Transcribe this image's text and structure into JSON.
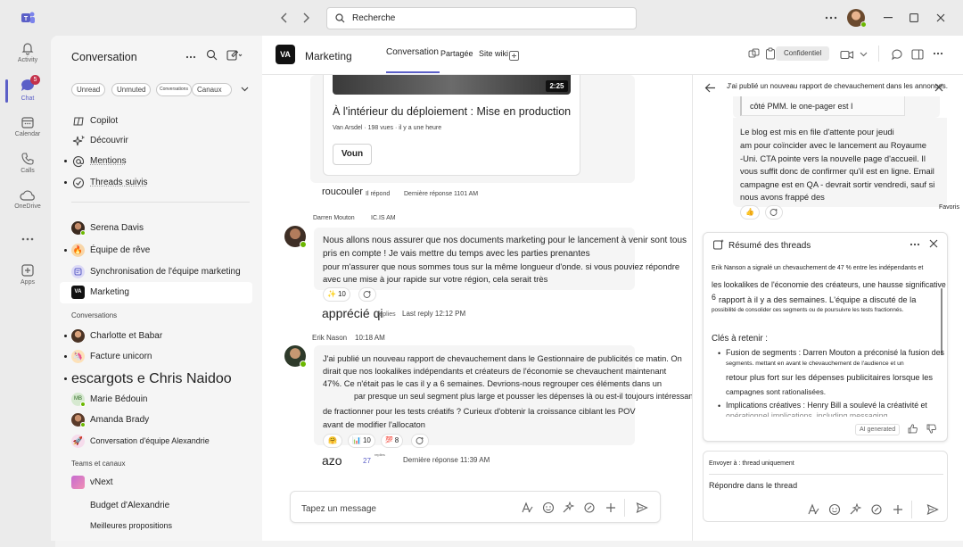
{
  "search": {
    "placeholder": "Recherche"
  },
  "rail": [
    {
      "label": "Activity",
      "icon": "bell-icon"
    },
    {
      "label": "Chat",
      "icon": "chat-icon",
      "badge": "5"
    },
    {
      "label": "Calendar",
      "icon": "calendar-icon"
    },
    {
      "label": "Calls",
      "icon": "phone-icon"
    },
    {
      "label": "OneDrive",
      "icon": "cloud-icon"
    },
    {
      "label": "Apps",
      "icon": "plus-square-icon"
    }
  ],
  "chatlist": {
    "title": "Conversation",
    "filters": [
      "Unread",
      "Unmuted",
      "Conversations",
      "Canaux"
    ],
    "items": [
      {
        "label": "Copilot",
        "icon": "copilot-icon"
      },
      {
        "label": "Découvrir",
        "icon": "sparkle-icon"
      },
      {
        "label": "Mentions",
        "icon": "at-icon"
      },
      {
        "label": "Threads suivis",
        "icon": "thread-icon"
      },
      {
        "label": "Serena Davis",
        "icon": "avatar"
      },
      {
        "label": "Équipe de rêve",
        "icon": "team-icon"
      },
      {
        "label": "Synchronisation de l'équipe marketing",
        "icon": "group-icon"
      },
      {
        "label": "Marketing",
        "icon": "marketing-logo"
      }
    ],
    "conv_header": "Conversations",
    "conversations": [
      {
        "label": "Charlotte et Babar"
      },
      {
        "label": "Facture unicorn"
      },
      {
        "label": "escargots e Chris Naidoo"
      },
      {
        "label": "Marie Bédouin",
        "initials": "MB"
      },
      {
        "label": "Amanda Brady"
      },
      {
        "label": "Conversation d'équipe Alexandrie"
      }
    ],
    "teams_header": "Teams et canaux",
    "teams": [
      {
        "label": "vNext"
      },
      {
        "label": "Budget d'Alexandrie"
      },
      {
        "label": "Meilleures propositions"
      }
    ]
  },
  "channel": {
    "logo": "VA",
    "name": "Marketing",
    "tabs": [
      "Conversation",
      "Partagée",
      "Site wiki"
    ],
    "confidential": "Confidentiel"
  },
  "video_card": {
    "duration": "2:25",
    "title": "À l'intérieur du déploiement : Mise en production",
    "meta_author": "Van Arsdel",
    "meta_views": "198 vues",
    "meta_time": "il y a une heure",
    "button": "Voun"
  },
  "post1_footer": {
    "name": "roucouler",
    "replied": "Il répond",
    "last": "Dernière réponse 1101 AM"
  },
  "msg2": {
    "author": "Darren Mouton",
    "time": "IC.IS AM",
    "line1": "Nous allons nous assurer que nos documents marketing pour le lancement à venir sont tous",
    "line2": "pris en compte ! Je vais mettre du temps avec les parties prenantes",
    "line3": "pour m'assurer que nous sommes tous sur la même longueur d'onde. si vous pouviez répondre",
    "line4": "avec une mise à jour rapide sur votre région, cela serait très",
    "reaction_count": "10",
    "footer_name": "apprécié qi",
    "footer_replies": "replies",
    "footer_last": "Last reply 12:12 PM"
  },
  "msg3": {
    "author": "Erik Nason",
    "time": "10:18 AM",
    "line1": "J'ai publié un nouveau rapport de chevauchement dans le Gestionnaire de publicités ce matin. On",
    "line2": "dirait que nos lookalikes indépendants et créateurs de l'économie se chevauchent maintenant",
    "line3": "47%. Ce n'était pas le cas il y a 6 semaines. Devrions-nous regrouper ces éléments dans un",
    "line4": "par presque un seul segment plus large et pousser les dépenses là ou est-il toujours intéressant",
    "line5": "de fractionner pour les tests créatifs ? Curieux d'obtenir la croissance ciblant les POV",
    "line6": "avant de modifier l'allocaton",
    "reactions": [
      "1",
      "10",
      "8"
    ],
    "footer_name": "azo",
    "footer_count": "27",
    "footer_replies": "replies",
    "footer_last": "Dernière réponse 11:39 AM"
  },
  "compose": {
    "placeholder": "Tapez un message"
  },
  "thread": {
    "title": "J'ai publié un nouveau rapport de chevauchement dans les annonces.",
    "quote": "côté PMM. le one-pager est I",
    "line1": "Le blog est mis en file d'attente pour jeudi",
    "line2": "am pour coïncider avec le lancement au Royaume",
    "line3": "-Uni. CTA pointe vers la nouvelle page d'accueil. Il",
    "line4": "vous suffit donc de confirmer qu'il est en ligne. Email",
    "line5": "campagne est en QA - devrait sortir vendredi, sauf si",
    "line6": "nous avons frappé des",
    "side_label": "Favoris"
  },
  "summary": {
    "title": "Résumé des threads",
    "p1": "Erik Nanson a signalé un chevauchement de 47 % entre les indépendants et",
    "p2": "les lookalikes de l'économie des créateurs, une hausse significative par",
    "p3_num": "6",
    "p3": "rapport à il y a des semaines. L'équipe a discuté de la",
    "p4": "possibilité de consolider ces segments ou de poursuivre les tests fractionnés.",
    "keys_title": "Clés à retenir :",
    "b1a": "Fusion de segments : Darren Mouton a préconisé la fusion des",
    "b1b": "segments. mettant en avant le chevauchement de l'audience et un",
    "b1c": "retour plus fort sur les dépenses publicitaires lorsque les",
    "b1d": "campagnes sont rationalisées.",
    "b2a": "Implications créatives : Henry Bill a soulevé la créativité et",
    "b2b": "opérationnel implications, including messaging",
    "ai": "AI generated"
  },
  "thread_compose": {
    "sendto": "Envoyer à : thread uniquement",
    "placeholder": "Répondre dans le thread"
  }
}
